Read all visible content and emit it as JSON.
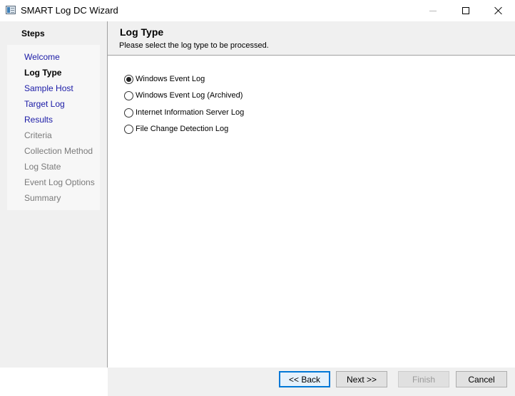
{
  "window": {
    "title": "SMART Log DC Wizard",
    "icons": {
      "app": "wizard-app-icon",
      "minimize": "minimize-icon",
      "maximize": "maximize-icon",
      "close": "close-icon"
    }
  },
  "sidebar": {
    "heading": "Steps",
    "items": [
      {
        "label": "Welcome",
        "state": "link"
      },
      {
        "label": "Log Type",
        "state": "current"
      },
      {
        "label": "Sample Host",
        "state": "link"
      },
      {
        "label": "Target Log",
        "state": "link"
      },
      {
        "label": "Results",
        "state": "link"
      },
      {
        "label": "Criteria",
        "state": "disabled"
      },
      {
        "label": "Collection Method",
        "state": "disabled"
      },
      {
        "label": "Log State",
        "state": "disabled"
      },
      {
        "label": "Event Log Options",
        "state": "disabled"
      },
      {
        "label": "Summary",
        "state": "disabled"
      }
    ]
  },
  "header": {
    "title": "Log Type",
    "subtitle": "Please select the log type to be processed."
  },
  "options": [
    {
      "label": "Windows Event Log",
      "checked": true
    },
    {
      "label": "Windows Event Log (Archived)",
      "checked": false
    },
    {
      "label": "Internet Information Server Log",
      "checked": false
    },
    {
      "label": "File Change Detection Log",
      "checked": false
    }
  ],
  "footer": {
    "back_label": "<< Back",
    "next_label": "Next >>",
    "finish_label": "Finish",
    "cancel_label": "Cancel",
    "finish_enabled": false
  },
  "colors": {
    "link": "#1a1aa6",
    "disabled_text": "#7a7a7a",
    "panel_bg": "#f0f0f0",
    "focus_border": "#0078d7"
  }
}
